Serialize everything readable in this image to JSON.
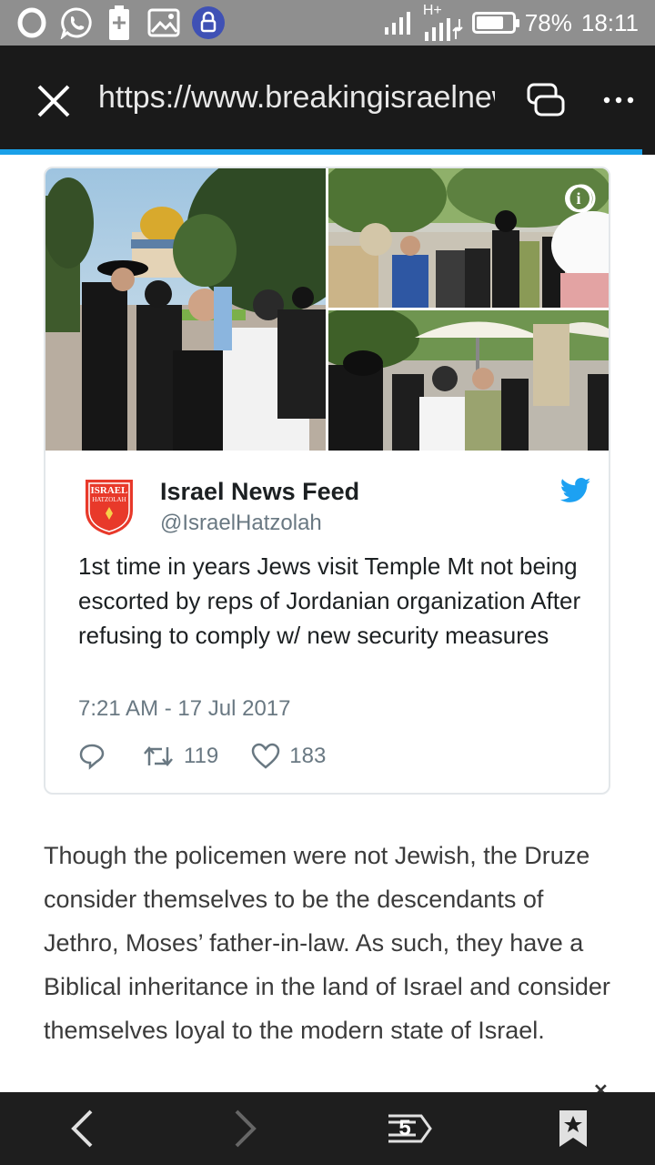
{
  "status_bar": {
    "network": "H+",
    "battery_level": 0.78,
    "battery": "78%",
    "time": "18:11",
    "icons": [
      "opera-icon",
      "whatsapp-icon",
      "battery-plus-icon",
      "gallery-icon",
      "lock-icon",
      "signal-icon",
      "h-plus-signal-icon",
      "battery-icon"
    ]
  },
  "browser": {
    "url": "https://www.breakingisraelnews.com",
    "load_progress": 0.98,
    "icons": {
      "close": "close-icon",
      "tabs": "tabs-icon",
      "menu": "more-icon"
    }
  },
  "tweet": {
    "author_name": "Israel News Feed",
    "author_handle": "@IsraelHatzolah",
    "avatar_text_top": "ISRAEL",
    "avatar_text_bottom": "HATZOLAH",
    "text": "1st time in years Jews visit Temple Mt not being escorted by reps of Jordanian organization After refusing to comply w/ new security measures",
    "timestamp": "7:21 AM - 17 Jul 2017",
    "retweets": "119",
    "likes": "183",
    "icons": {
      "reply": "reply-icon",
      "retweet": "retweet-icon",
      "like": "heart-icon",
      "brand": "twitter-bird-icon",
      "info": "info-icon"
    },
    "colors": {
      "twitter_blue": "#1da1f2",
      "meta_gray": "#697882"
    }
  },
  "article": {
    "paragraph": "Though the policemen were not Jewish, the Druze consider themselves to be the descendants of Jethro, Moses’ father-in-law. As such, they have a Biblical inheritance in the land of Israel and consider themselves loyal to the modern state of Israel."
  },
  "bottom_nav": {
    "tab_count": "5",
    "icons": [
      "back-icon",
      "forward-icon",
      "tabs-count-icon",
      "bookmark-icon"
    ]
  }
}
